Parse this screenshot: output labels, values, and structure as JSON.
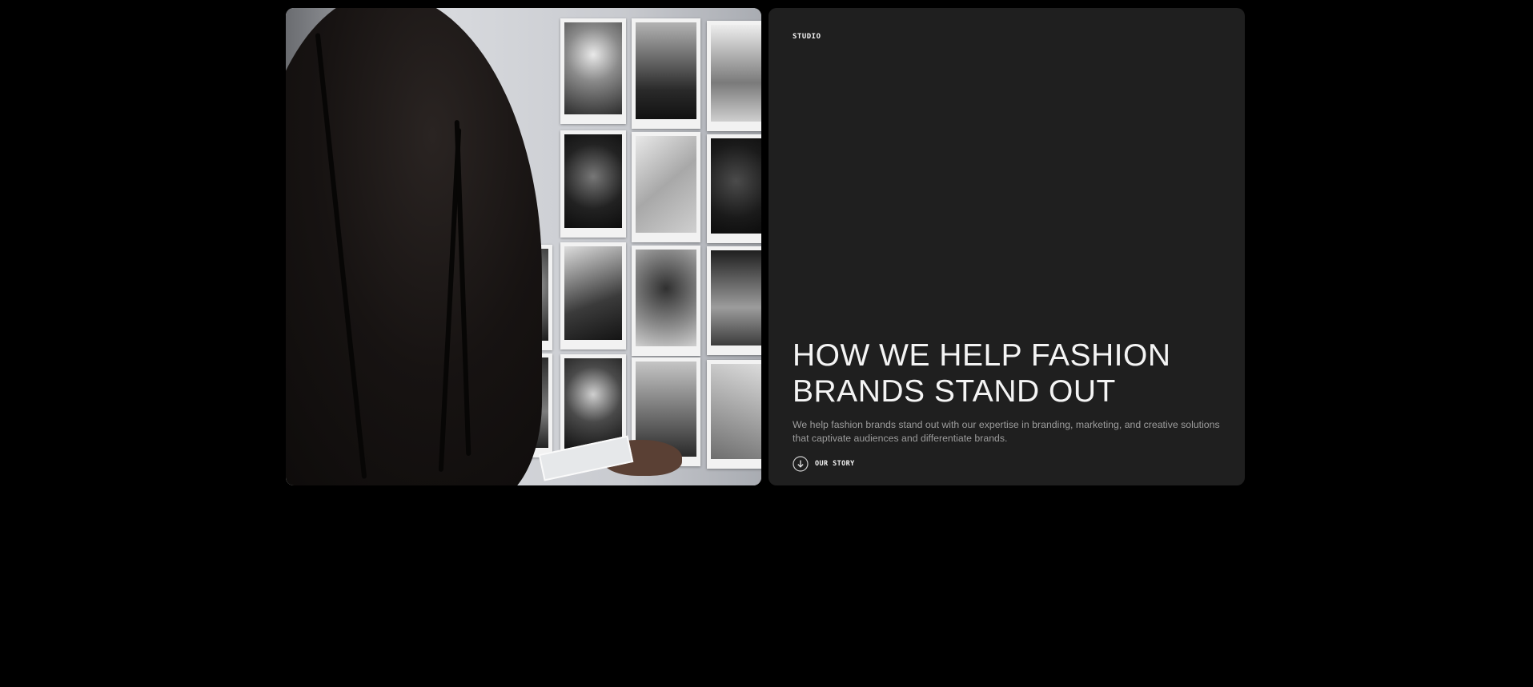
{
  "section": {
    "tag": "STUDIO",
    "heading_line1": "HOW WE HELP FASHION",
    "heading_line2": "BRANDS STAND OUT",
    "description": "We help fashion brands stand out with our expertise in branding, marketing, and creative solutions that captivate audiences and differentiate brands.",
    "cta_label": "OUR STORY",
    "cta_icon": "arrow-down-circle-icon"
  },
  "colors": {
    "page_background": "#000000",
    "card_background": "#1f1f1f",
    "heading": "#f4f4f4",
    "description": "#9c9c9c"
  },
  "image": {
    "subject": "photo-wall-with-model"
  }
}
